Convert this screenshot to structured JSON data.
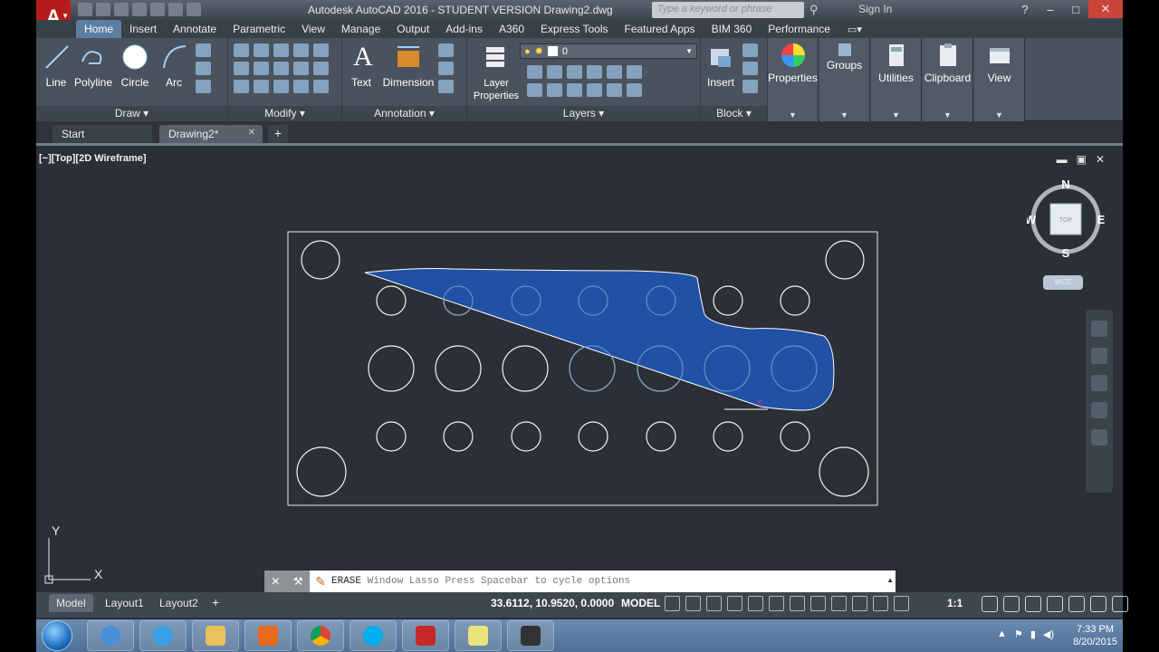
{
  "window": {
    "title": "Autodesk AutoCAD 2016 - STUDENT VERSION    Drawing2.dwg",
    "search_placeholder": "Type a keyword or phrase",
    "user": "Sign In"
  },
  "ribbon_tabs": [
    "Home",
    "Insert",
    "Annotate",
    "Parametric",
    "View",
    "Manage",
    "Output",
    "Add-ins",
    "A360",
    "Express Tools",
    "Featured Apps",
    "BIM 360",
    "Performance"
  ],
  "panels": {
    "draw": {
      "title": "Draw",
      "tools": [
        "Line",
        "Polyline",
        "Circle",
        "Arc"
      ]
    },
    "modify": {
      "title": "Modify"
    },
    "annotation": {
      "title": "Annotation",
      "tools": [
        "Text",
        "Dimension"
      ]
    },
    "layers": {
      "title": "Layers",
      "tool": "Layer Properties",
      "current_layer": "0"
    },
    "block": {
      "title": "Block",
      "tool": "Insert"
    },
    "properties": {
      "label": "Properties"
    },
    "groups": {
      "label": "Groups"
    },
    "utilities": {
      "label": "Utilities"
    },
    "clipboard": {
      "label": "Clipboard"
    },
    "view": {
      "label": "View"
    }
  },
  "doc_tabs": {
    "start": "Start",
    "drawing": "Drawing2*"
  },
  "viewport": {
    "label": "[−][Top][2D Wireframe]",
    "viewcube": {
      "n": "N",
      "s": "S",
      "e": "E",
      "w": "W",
      "face": "TOP",
      "wcs": "WCS"
    },
    "ucs": {
      "x": "X",
      "y": "Y"
    }
  },
  "command_line": {
    "command": "ERASE",
    "text": "Window Lasso  Press Spacebar to cycle options"
  },
  "layout_tabs": [
    "Model",
    "Layout1",
    "Layout2"
  ],
  "status_bar": {
    "coordinates": "33.6112, 10.9520, 0.0000",
    "space": "MODEL",
    "scale": "1:1"
  },
  "taskbar": {
    "time": "7:33 PM",
    "date": "8/20/2015"
  },
  "colors": {
    "lasso_fill": "#1f56b5",
    "canvas": "#2b2f36",
    "accent": "#5b7ea3"
  }
}
